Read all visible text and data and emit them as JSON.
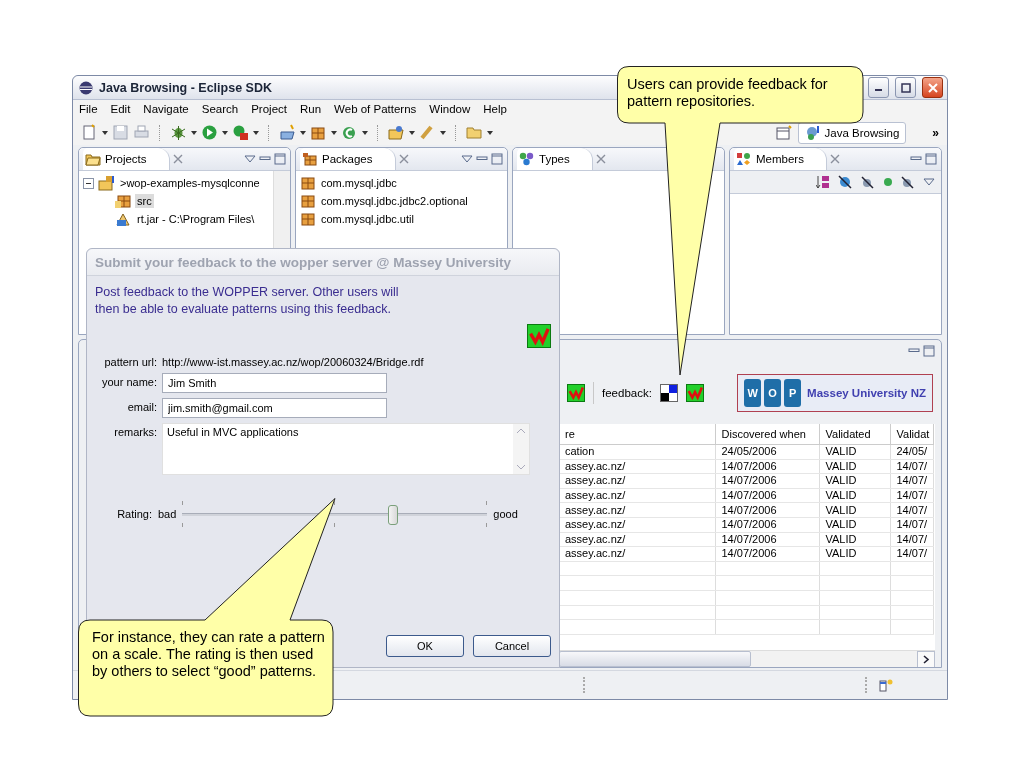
{
  "window": {
    "title": "Java Browsing - Eclipse SDK"
  },
  "menu": [
    "File",
    "Edit",
    "Navigate",
    "Search",
    "Project",
    "Run",
    "Web of Patterns",
    "Window",
    "Help"
  ],
  "perspective": {
    "label": "Java Browsing",
    "more": "»"
  },
  "views": [
    {
      "title": "Projects",
      "kind": "tree",
      "items": [
        {
          "label": ">wop-examples-mysqlconne",
          "kind": "project",
          "expanded": true,
          "selected": false,
          "children": [
            {
              "label": "src",
              "kind": "source",
              "selected": true
            },
            {
              "label": "rt.jar - C:\\Program Files\\",
              "kind": "jar",
              "selected": false
            }
          ]
        }
      ]
    },
    {
      "title": "Packages",
      "kind": "list",
      "items": [
        {
          "label": "com.mysql.jdbc",
          "selected": false
        },
        {
          "label": "com.mysql.jdbc.jdbc2.optional",
          "selected": false
        },
        {
          "label": "com.mysql.jdbc.util",
          "selected": false
        }
      ]
    },
    {
      "title": "Types",
      "kind": "list"
    },
    {
      "title": "Members",
      "kind": "members"
    }
  ],
  "bottom_panel": {
    "feedback_label": "feedback:",
    "logo": {
      "letters": [
        "W",
        "O",
        "P"
      ],
      "caption": "Massey University NZ"
    },
    "table": {
      "columns": [
        "re",
        "Discovered when",
        "Validated",
        "Validat"
      ],
      "rows": [
        [
          "cation",
          "24/05/2006",
          "VALID",
          "24/05/"
        ],
        [
          "assey.ac.nz/",
          "14/07/2006",
          "VALID",
          "14/07/"
        ],
        [
          "assey.ac.nz/",
          "14/07/2006",
          "VALID",
          "14/07/"
        ],
        [
          "assey.ac.nz/",
          "14/07/2006",
          "VALID",
          "14/07/"
        ],
        [
          "assey.ac.nz/",
          "14/07/2006",
          "VALID",
          "14/07/"
        ],
        [
          "assey.ac.nz/",
          "14/07/2006",
          "VALID",
          "14/07/"
        ],
        [
          "assey.ac.nz/",
          "14/07/2006",
          "VALID",
          "14/07/"
        ],
        [
          "assey.ac.nz/",
          "14/07/2006",
          "VALID",
          "14/07/"
        ]
      ]
    }
  },
  "dialog": {
    "title": "Submit your feedback to the wopper server @ Massey University",
    "description": "Post feedback to the WOPPER server. Other users will then be able to evaluate patterns using this feedback.",
    "fields": [
      {
        "kind": "text",
        "label": "pattern url:",
        "value": "http://www-ist.massey.ac.nz/wop/20060324/Bridge.rdf"
      },
      {
        "kind": "input",
        "label": "your name:",
        "value": "Jim Smith"
      },
      {
        "kind": "input",
        "label": "email:",
        "value": "jim.smith@gmail.com"
      },
      {
        "kind": "textarea",
        "label": "remarks:",
        "value": "Useful in MVC applications"
      }
    ],
    "rating": {
      "label": "Rating:",
      "low": "bad",
      "high": "good",
      "level": 0.69
    },
    "buttons": [
      "OK",
      "Cancel"
    ]
  },
  "callouts": [
    {
      "text": "Users can provide feedback for pattern repositories."
    },
    {
      "text": "For instance, they can rate a pattern on a scale. The rating is then used by others to select “good” patterns."
    }
  ]
}
